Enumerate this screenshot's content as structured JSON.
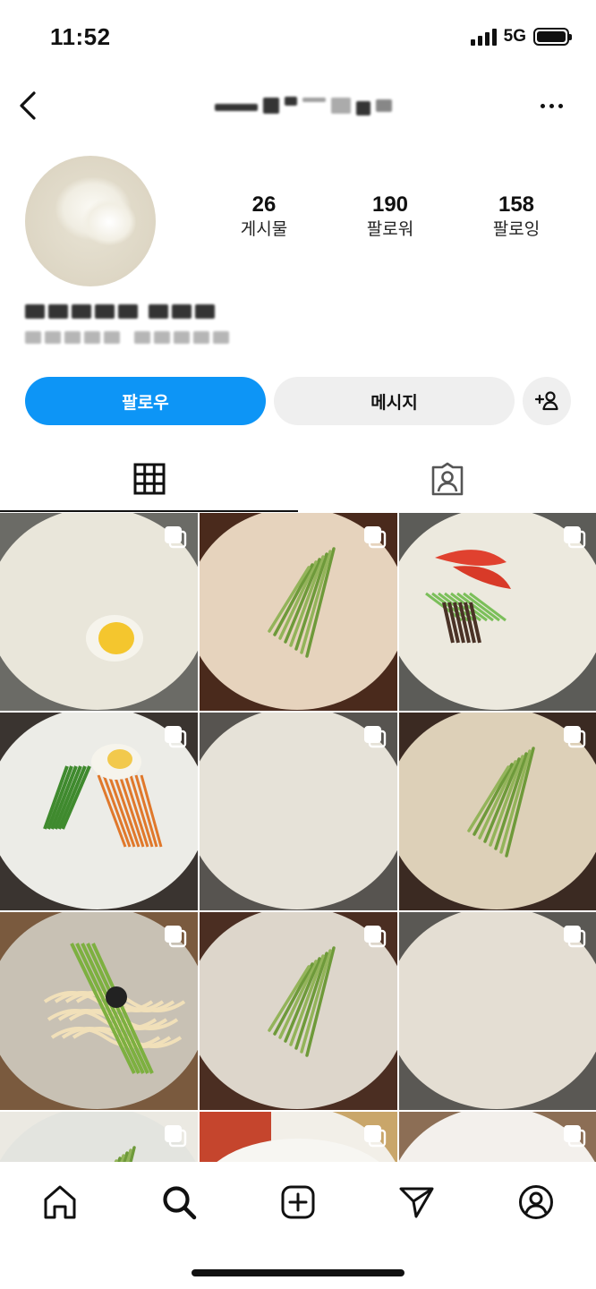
{
  "status_bar": {
    "time": "11:52",
    "network": "5G"
  },
  "header": {
    "back_icon": "chevron-left-icon",
    "more_icon": "more-dots-icon"
  },
  "profile": {
    "stats": [
      {
        "value": "26",
        "label": "게시물"
      },
      {
        "value": "190",
        "label": "팔로워"
      },
      {
        "value": "158",
        "label": "팔로잉"
      }
    ]
  },
  "actions": {
    "follow_label": "팔로우",
    "message_label": "메시지",
    "add_person_icon": "add-person-icon"
  },
  "tabs": [
    {
      "name": "posts",
      "icon": "grid-icon",
      "active": true
    },
    {
      "name": "tagged",
      "icon": "tagged-person-icon",
      "active": false
    }
  ],
  "posts": [
    {
      "bg": "#6b6b66",
      "soup": "#e9e6da",
      "accent": "egg"
    },
    {
      "bg": "#4a2a1c",
      "soup": "#e6d3bd",
      "accent": "cucumber"
    },
    {
      "bg": "#5c5c58",
      "soup": "#ece9de",
      "accent": "tomato"
    },
    {
      "bg": "#3a3430",
      "soup": "#ecece7",
      "accent": "egg-carrot"
    },
    {
      "bg": "#575450",
      "soup": "#e6e2d8",
      "accent": "none"
    },
    {
      "bg": "#3b2a22",
      "soup": "#ddd0b8",
      "accent": "cucumber"
    },
    {
      "bg": "#7a5a3e",
      "soup": "#c8c1b4",
      "accent": "noodles"
    },
    {
      "bg": "#4b2e22",
      "soup": "#ddd6cb",
      "accent": "cucumber"
    },
    {
      "bg": "#5a5854",
      "soup": "#e4ded3",
      "accent": "none"
    },
    {
      "bg": "#ebe9e2",
      "soup": "#e3e4df",
      "accent": "cucumber"
    },
    {
      "bg": "#c9a66a",
      "soup": "#f2efe8",
      "accent": "side"
    },
    {
      "bg": "#8c6e55",
      "soup": "#f3f0ec",
      "accent": "none"
    }
  ],
  "bottom_nav": [
    {
      "name": "home",
      "icon": "home-icon"
    },
    {
      "name": "search",
      "icon": "search-icon"
    },
    {
      "name": "new-post",
      "icon": "plus-square-icon"
    },
    {
      "name": "direct",
      "icon": "send-icon"
    },
    {
      "name": "profile",
      "icon": "profile-icon"
    }
  ],
  "colors": {
    "follow_button": "#0d95f6",
    "secondary_button": "#efefef",
    "text": "#111111"
  }
}
